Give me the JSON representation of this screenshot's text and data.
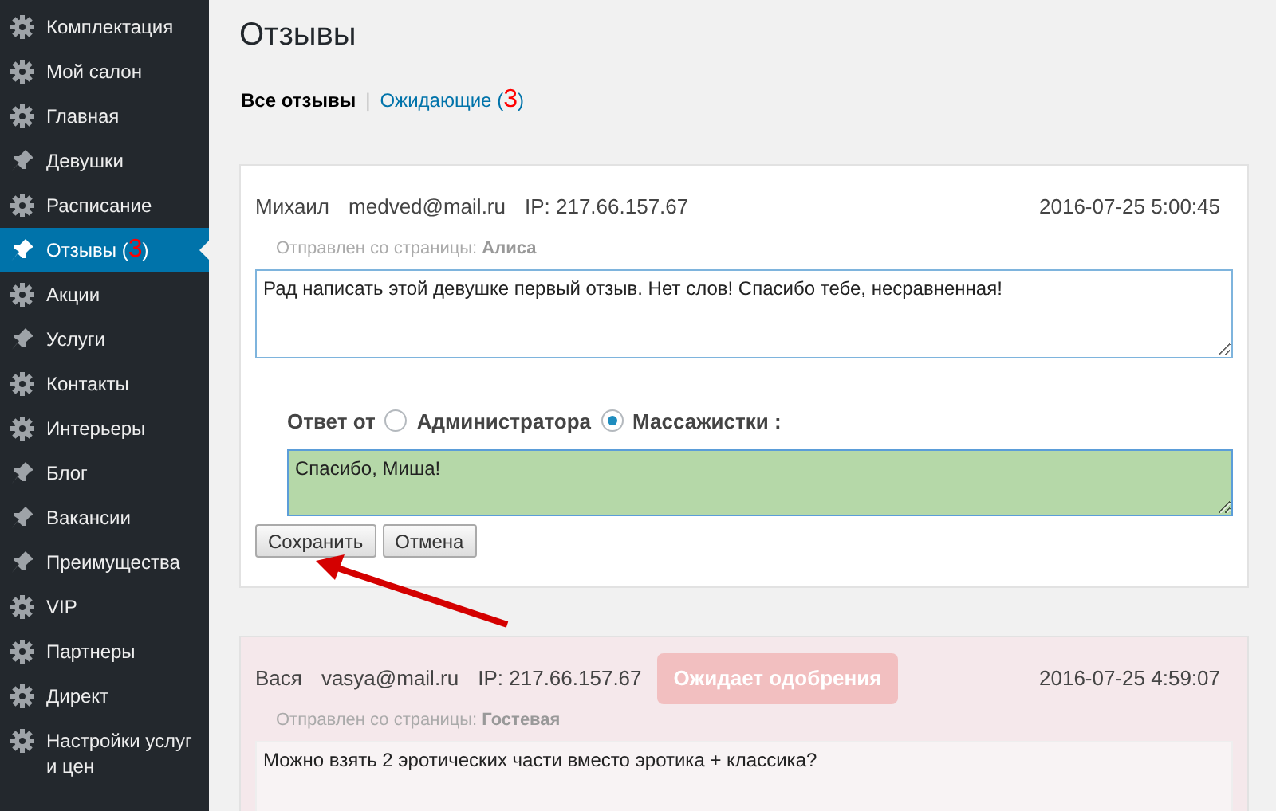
{
  "sidebar": {
    "items": [
      {
        "label": "Комплектация",
        "kind": "gear",
        "selected": false
      },
      {
        "label": "Мой салон",
        "kind": "gear",
        "selected": false
      },
      {
        "label": "Главная",
        "kind": "gear",
        "selected": false
      },
      {
        "label": "Девушки",
        "kind": "pin",
        "selected": false
      },
      {
        "label": "Расписание",
        "kind": "gear",
        "selected": false
      },
      {
        "label": "Отзывы",
        "count": "(3)",
        "kind": "pin",
        "selected": true
      },
      {
        "label": "Акции",
        "kind": "gear",
        "selected": false
      },
      {
        "label": "Услуги",
        "kind": "pin",
        "selected": false
      },
      {
        "label": "Контакты",
        "kind": "gear",
        "selected": false
      },
      {
        "label": "Интерьеры",
        "kind": "gear",
        "selected": false
      },
      {
        "label": "Блог",
        "kind": "pin",
        "selected": false
      },
      {
        "label": "Вакансии",
        "kind": "pin",
        "selected": false
      },
      {
        "label": "Преимущества",
        "kind": "pin",
        "selected": false
      },
      {
        "label": "VIP",
        "kind": "gear",
        "selected": false
      },
      {
        "label": "Партнеры",
        "kind": "gear",
        "selected": false
      },
      {
        "label": "Директ",
        "kind": "gear",
        "selected": false
      },
      {
        "label": "Настройки услуг и цен",
        "kind": "gear",
        "selected": false
      }
    ]
  },
  "page": {
    "title": "Отзывы"
  },
  "filters": {
    "separator": "|",
    "items": [
      {
        "label": "Все отзывы",
        "selected": true
      },
      {
        "label": "Ожидающие",
        "count": "(3)",
        "selected": false
      }
    ]
  },
  "reviews": [
    {
      "name": "Михаил",
      "email": "medved@mail.ru",
      "ip": "IP: 217.66.157.67",
      "pending": false,
      "date": "2016-07-25 5:00:45",
      "source_label": "Отправлен со страницы:",
      "source": "Алиса",
      "text": "Рад написать этой девушке первый отзыв. Нет слов! Спасибо тебе, несравненная!",
      "reply": {
        "label": "Ответ от",
        "options": [
          {
            "label": "Администратора",
            "selected": false
          },
          {
            "label": "Массажистки :",
            "selected": true
          }
        ],
        "value": "Спасибо, Миша!"
      },
      "buttons": [
        "Сохранить",
        "Отмена"
      ]
    },
    {
      "name": "Вася",
      "email": "vasya@mail.ru",
      "ip": "IP: 217.66.157.67",
      "pending": true,
      "badge": "Ожидает одобрения",
      "date": "2016-07-25 4:59:07",
      "source_label": "Отправлен со страницы:",
      "source": "Гостевая",
      "text": "Можно взять 2 эротических части вместо эротика + классика?"
    }
  ]
}
